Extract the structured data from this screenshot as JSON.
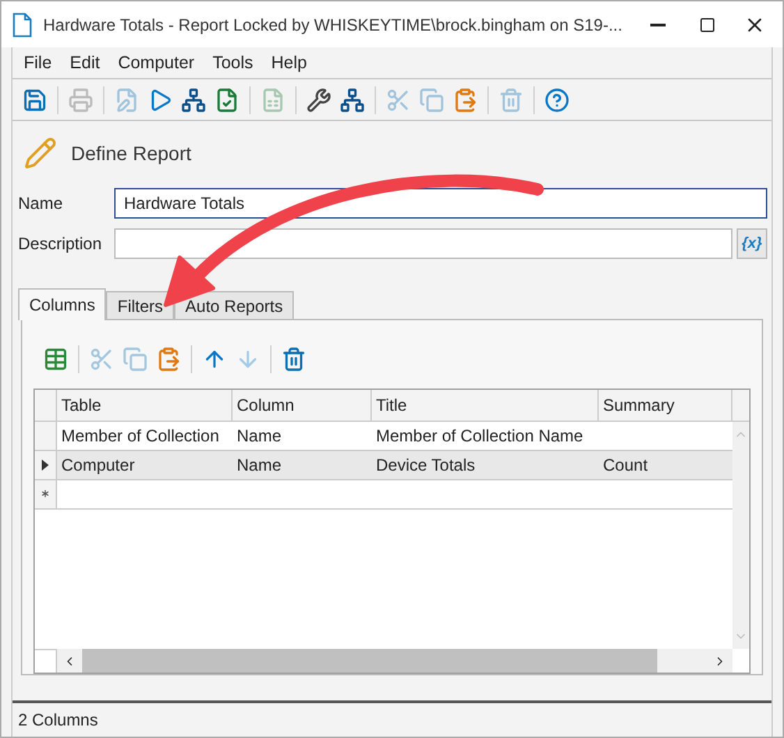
{
  "window": {
    "title": "Hardware Totals - Report Locked by WHISKEYTIME\\brock.bingham on S19-..."
  },
  "menu": [
    "File",
    "Edit",
    "Computer",
    "Tools",
    "Help"
  ],
  "toolbar": [
    {
      "kind": "save",
      "disabled": false
    },
    {
      "kind": "sep"
    },
    {
      "kind": "print",
      "disabled": true
    },
    {
      "kind": "sep"
    },
    {
      "kind": "edit",
      "disabled": true
    },
    {
      "kind": "run",
      "disabled": false
    },
    {
      "kind": "network",
      "disabled": false
    },
    {
      "kind": "check",
      "disabled": false
    },
    {
      "kind": "sep"
    },
    {
      "kind": "csv",
      "disabled": true
    },
    {
      "kind": "sep"
    },
    {
      "kind": "tools",
      "disabled": false
    },
    {
      "kind": "network",
      "disabled": false
    },
    {
      "kind": "sep"
    },
    {
      "kind": "cut",
      "disabled": true
    },
    {
      "kind": "copy",
      "disabled": true
    },
    {
      "kind": "paste",
      "disabled": false
    },
    {
      "kind": "sep"
    },
    {
      "kind": "delete",
      "disabled": true
    },
    {
      "kind": "sep"
    },
    {
      "kind": "help",
      "disabled": false
    }
  ],
  "heading": "Define Report",
  "name_field": {
    "label": "Name",
    "value": "Hardware Totals"
  },
  "description_field": {
    "label": "Description",
    "button": "{x}"
  },
  "tabs": [
    {
      "label": "Columns",
      "selected": true
    },
    {
      "label": "Filters",
      "selected": false
    },
    {
      "label": "Auto Reports",
      "selected": false
    }
  ],
  "grid_toolbar": [
    {
      "kind": "table",
      "disabled": false
    },
    {
      "kind": "sep"
    },
    {
      "kind": "cut",
      "disabled": true
    },
    {
      "kind": "copy",
      "disabled": true
    },
    {
      "kind": "paste",
      "disabled": false
    },
    {
      "kind": "sep"
    },
    {
      "kind": "up",
      "disabled": false
    },
    {
      "kind": "down",
      "disabled": true
    },
    {
      "kind": "sep"
    },
    {
      "kind": "delete",
      "disabled": false
    }
  ],
  "table": {
    "columns": [
      "Table",
      "Column",
      "Title",
      "Summary"
    ],
    "rows": [
      {
        "cells": [
          "Member of Collection",
          "Name",
          "Member of Collection Name",
          ""
        ],
        "selected": false
      },
      {
        "cells": [
          "Computer",
          "Name",
          "Device Totals",
          "Count"
        ],
        "selected": true
      }
    ]
  },
  "status_bar": "2 Columns"
}
